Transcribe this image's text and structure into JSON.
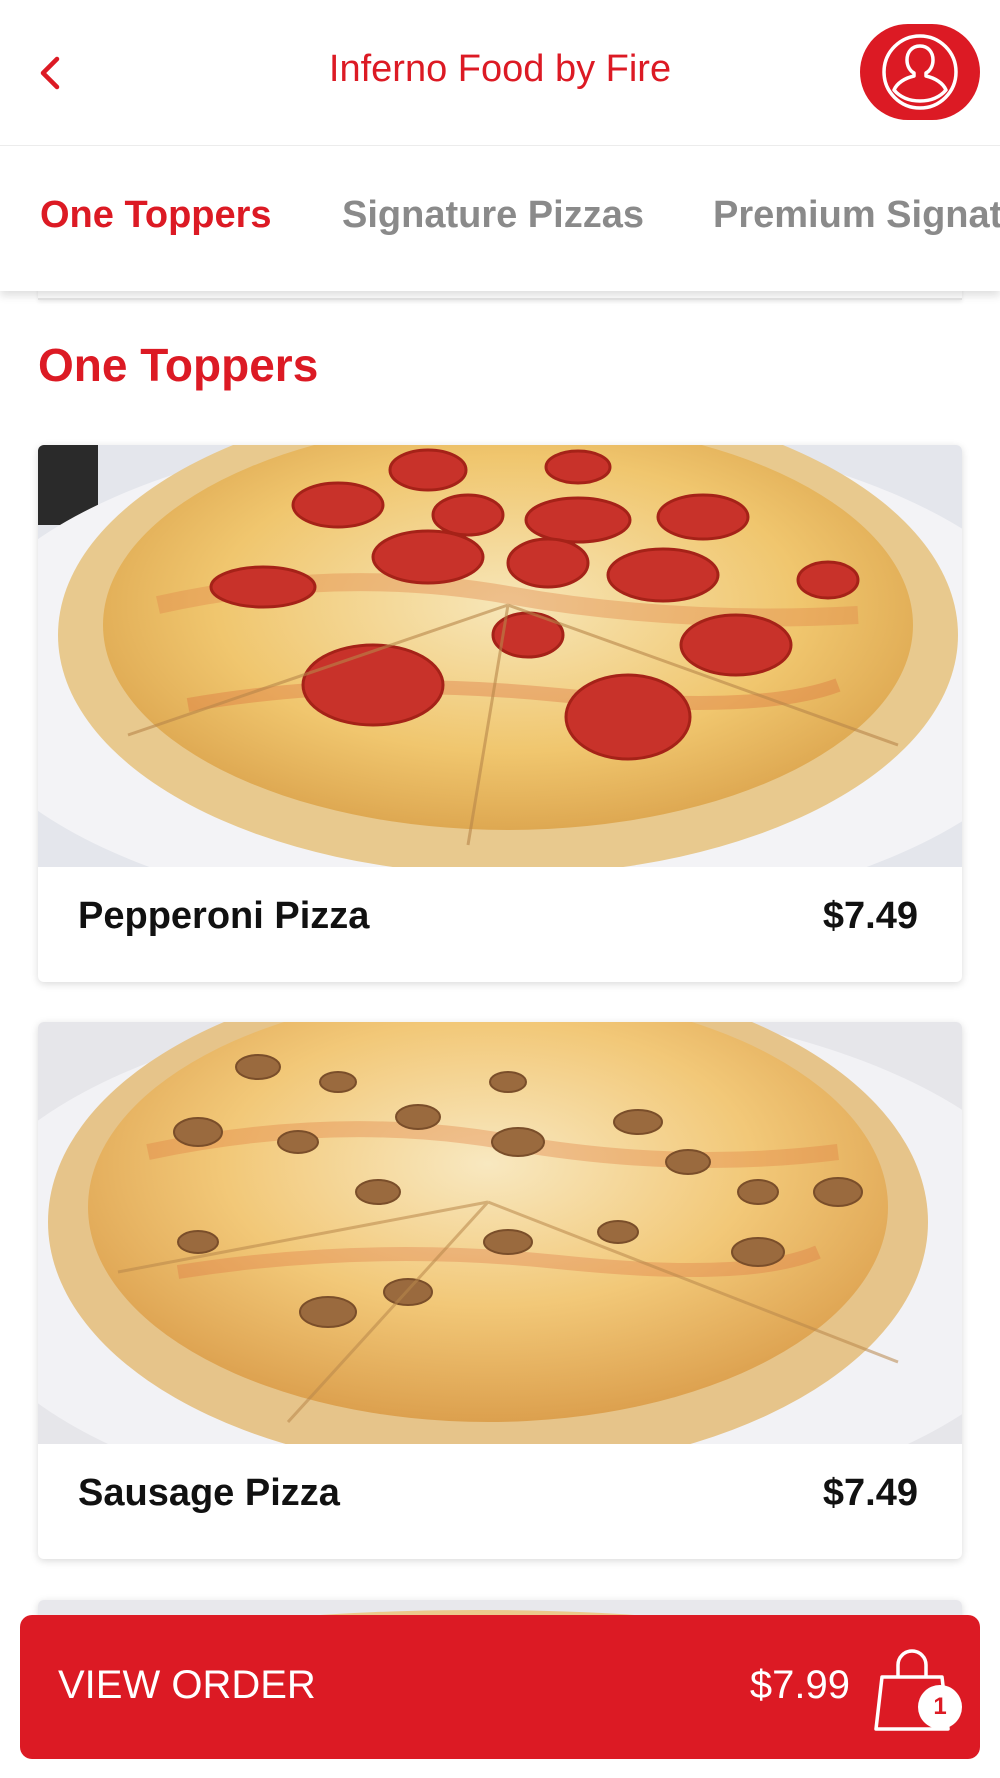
{
  "header": {
    "title": "Inferno Food by Fire",
    "back_icon": "chevron-left-icon",
    "profile_icon": "user-icon"
  },
  "tabs": [
    {
      "label": "One Toppers",
      "active": true
    },
    {
      "label": "Signature Pizzas",
      "active": false
    },
    {
      "label": "Premium Signature Pizzas",
      "active": false
    }
  ],
  "section": {
    "title": "One Toppers"
  },
  "items": [
    {
      "name": "Pepperoni Pizza",
      "price": "$7.49",
      "image": "pepperoni-pizza-photo"
    },
    {
      "name": "Sausage Pizza",
      "price": "$7.49",
      "image": "sausage-pizza-photo"
    }
  ],
  "order_bar": {
    "label": "VIEW ORDER",
    "total": "$7.99",
    "cart_count": "1",
    "cart_icon": "shopping-bag-icon"
  },
  "colors": {
    "accent": "#dc1a24",
    "tab_inactive": "#8a8a8a",
    "text": "#111111"
  }
}
